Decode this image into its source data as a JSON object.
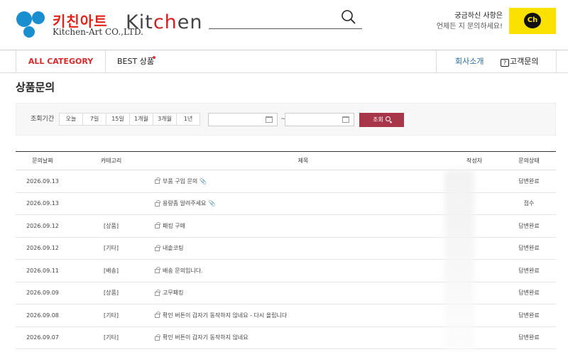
{
  "header": {
    "logo_ko": "키친아트",
    "logo_en": "Kitchen-Art CO.,LTD.",
    "logo_kitchen_k": "K",
    "logo_kitchen_mid": "it",
    "logo_kitchen_ch": "ch",
    "logo_kitchen_en": "en",
    "cs_line1": "궁금하신 사항은",
    "cs_line2": "언제든 지 문의하세요!",
    "kakao_label": "Ch",
    "brand_color": "#e2231a",
    "kakao_color": "#fae100"
  },
  "nav": {
    "all_category": "ALL CATEGORY",
    "best": "BEST 상품",
    "about": "회사소개",
    "help_icon": "?",
    "help": "고객문의"
  },
  "page_title": "상품문의",
  "filter": {
    "label": "조회기간",
    "periods": [
      "오늘",
      "7일",
      "15일",
      "1개월",
      "3개월",
      "1년"
    ],
    "tilde": "~",
    "search_label": "조회",
    "button_color": "#a8364a"
  },
  "table": {
    "headers": [
      "문의날짜",
      "카테고리",
      "제목",
      "작성자",
      "문의상태"
    ],
    "rows": [
      {
        "date": "2026.09.13",
        "category": "",
        "title": "부품 구입 문의",
        "attach": true,
        "status": "답변완료"
      },
      {
        "date": "2026.09.13",
        "category": "",
        "title": "용량좀 알려주세요",
        "attach": true,
        "status": "접수"
      },
      {
        "date": "2026.09.12",
        "category": "[상품]",
        "title": "패킹 구매",
        "attach": false,
        "status": "답변완료"
      },
      {
        "date": "2026.09.12",
        "category": "[기타]",
        "title": "내솥코팅",
        "attach": false,
        "status": "답변완료"
      },
      {
        "date": "2026.09.11",
        "category": "[배송]",
        "title": "배송 문의입니다.",
        "attach": false,
        "status": "답변완료"
      },
      {
        "date": "2026.09.09",
        "category": "[상품]",
        "title": "고무패킹",
        "attach": false,
        "status": "답변완료"
      },
      {
        "date": "2026.09.08",
        "category": "[기타]",
        "title": "확인 버튼이 갑자기 동작하지 않네요 - 다시 올립니다",
        "attach": false,
        "status": "답변완료"
      },
      {
        "date": "2026.09.07",
        "category": "[기타]",
        "title": "확인 버튼이 갑자기 동작하지 않네요",
        "attach": false,
        "status": "답변완료"
      }
    ]
  }
}
